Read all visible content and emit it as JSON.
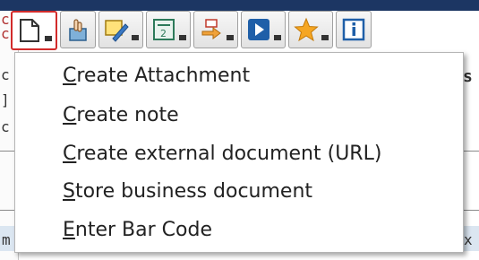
{
  "toolbar": {
    "buttons": [
      {
        "icon": "new-document-icon",
        "dropdown": true,
        "active": true
      },
      {
        "icon": "hand-icon",
        "dropdown": false
      },
      {
        "icon": "pen-note-icon",
        "dropdown": true
      },
      {
        "icon": "document-list-icon",
        "dropdown": true
      },
      {
        "icon": "workflow-arrows-icon",
        "dropdown": true
      },
      {
        "icon": "play-icon",
        "dropdown": true
      },
      {
        "icon": "star-icon",
        "dropdown": true
      },
      {
        "icon": "info-icon",
        "dropdown": false
      }
    ]
  },
  "menu": {
    "items": [
      {
        "accelerator": "C",
        "rest": "reate Attachment"
      },
      {
        "accelerator": "C",
        "rest": "reate note"
      },
      {
        "accelerator": "C",
        "rest": "reate external document (URL)"
      },
      {
        "accelerator": "S",
        "rest": "tore business document"
      },
      {
        "accelerator": "E",
        "rest": "nter Bar Code"
      }
    ]
  },
  "background": {
    "left_chars": [
      "c",
      "c",
      "c",
      "]",
      "c"
    ],
    "right_char_top": "s",
    "right_char_bottom": "x",
    "left_char_bottom": "m"
  },
  "colors": {
    "toolbar_active_border": "#d22b2b",
    "window_title_bar": "#1c3663",
    "menu_background": "#ffffff",
    "selection_band": "#dbe6f1"
  }
}
